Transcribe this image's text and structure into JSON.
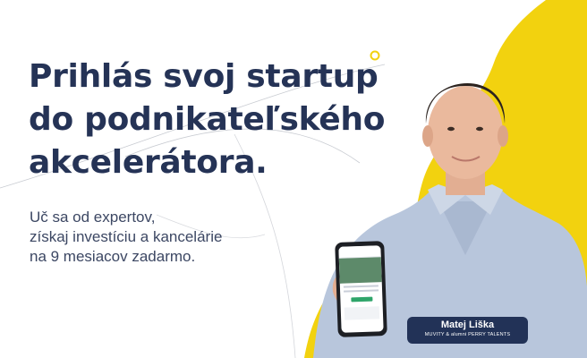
{
  "headline": {
    "line1": "Prihlás svoj startup",
    "line2": "do podnikateľského",
    "line3": "akcelerátora."
  },
  "subtext": {
    "line1": "Uč sa od expertov,",
    "line2": "získaj investíciu a kancelárie",
    "line3": "na 9 mesiacov zadarmo."
  },
  "nameplate": {
    "name": "Matej Liška",
    "role": "MUVITY & alumni PERRY TALENTS"
  },
  "colors": {
    "navy": "#253356",
    "yellow": "#f2d20f",
    "shirt": "#b8c6dc",
    "background": "#ffffff"
  }
}
